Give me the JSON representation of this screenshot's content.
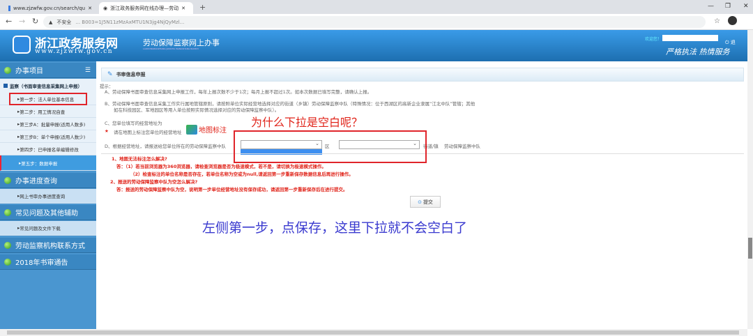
{
  "browser": {
    "tabs": [
      {
        "title": "www.zjzwfw.gov.cn/search/qu"
      },
      {
        "title": "浙江政务服务网在线办理—劳动"
      }
    ],
    "new_tab": "+",
    "security_label": "不安全",
    "url": "... B003=1J5N11zMzAxMTU1N3jg4NjQyMzl..."
  },
  "header": {
    "logo_title": "浙江政务服务网",
    "logo_url": "www.zjzwfw.gov.cn",
    "subtitle": "劳动保障监察网上办事",
    "subtitle_pinyin": "LAODONGBAOZHANG JIANCHA WANGSHANG BANSHI",
    "welcome": "欢迎您！",
    "logout": "退",
    "slogan": "严格执法 热情服务"
  },
  "sidebar": {
    "section1": "办事项目",
    "group": "监察（书面审查信息采集网上申报）",
    "steps": [
      "第一步：法人单位基本信息",
      "第二步：用工情况自查",
      "第三步A：批量申报(适用人数多)",
      "第三步B：单个申报(适用人数少)",
      "第四步：已申报名单编辑修改",
      "第五步：数据申报"
    ],
    "section2": "办事进度查询",
    "section2_sub": "网上书审办事进度查询",
    "section3": "常见问题及其他辅助",
    "section3_sub": "常见问题及文件下载",
    "section4": "劳动监察机构联系方式",
    "section5": "2018年书审通告"
  },
  "panel": {
    "title": "书审信息申报",
    "hint_label": "提示：",
    "a": "A、劳动保障书面审查信息采集网上申报工作，每年上报次数不少于1次；每月上报不超过1次。如本次数据已填写完整，请确认上报。",
    "b1": "B、劳动保障书面审查信息采集工作实行属地管辖原则，请按照单位实际经营地选择对应的街道（乡镇）劳动保障监察中队（特殊情况：位于西湖区的高新企业隶属“江北中队”管辖；其他",
    "b2": "如在科技园区、军地园区等用人单位按照实际情况选择对应的劳动保障监察中队）。",
    "c": "C、您单位填写的经营地址为",
    "star": "★",
    "map_hint": "请在地图上标注您单位的经营地址",
    "map_link": "地图标注",
    "d": "D、根据经营地址，请报送给您单位所在的劳动保障监察中队",
    "district": "区",
    "street_suffix": "街道/镇",
    "team_suffix": "劳动保障监察中队",
    "faq": [
      "1、地图无法标注怎么解决?",
      "答：（1）若当前浏览器为360浏览器，请检查浏览器是否为极速模式，若不是，请切换为极速模式操作。",
      "（2）检查标注的单位名称是否存在，若单位名称为空或为null,请返回第一步重新保存数据信息后再进行操作。",
      "2、报送的劳动保障监察中队为空怎么解决?",
      "答：报送的劳动保障监察中队为空，说明第一步单位经营地址没有保存成功，请返回第一步重新保存后在进行提交。"
    ],
    "submit": "提交"
  },
  "annotations": {
    "question": "为什么下拉是空白呢？",
    "answer": "左侧第一步，点保存，这里下拉就不会空白了"
  }
}
